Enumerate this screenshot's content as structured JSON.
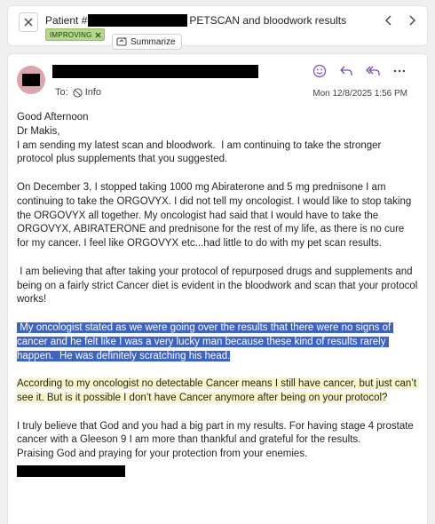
{
  "header": {
    "subject_prefix": "Patient #",
    "subject_suffix": "PETSCAN and bloodwork results",
    "badge": "IMPROVING",
    "summarize_label": "Summarize"
  },
  "message": {
    "to_label": "To:",
    "info_label": "Info",
    "date": "Mon 12/8/2025 1:56 PM",
    "greeting_1": "Good Afternoon",
    "greeting_2": "Dr Makis,",
    "p1": "I am sending my latest scan and bloodwork.  I am continuing to take the stronger protocol plus supplements that you suggested.",
    "p2": "On December 3, I stopped taking 1000 mg Abiraterone and 5 mg prednisone I am continuing to take the ORGOVYX. I did not tell my oncologist. I would like to stop taking the ORGOVYX all together. My oncologist had said that I would have to take the ORGOVYX, ABIRATERONE and prednisone for the rest of my life, as there is no cure for my cancer. I feel like ORGOVYX etc...had little to do with my pet scan results.",
    "p3": " I am believing that after taking your protocol of repurposed drugs and supplements and being on a fairly strict Cancer diet is evident in the bloodwork and scan that your protocol works!",
    "p4": " My oncologist stated as we were going over the results that there were no signs of cancer and he felt like I was a very lucky man because these kind of results rarely happen.  He was definitely scratching his head.",
    "p5": "According to my oncologist no detectable Cancer means I still have cancer, but just can’t see it. But is it possible I don’t have Cancer anymore after being on your protocol?",
    "p6": "I truly believe that God and you had a big part in my results. For having stage 4 prostate cancer with a Gleeson 9 I am more than thankful and grateful for the results.",
    "p7": "Praising God and praying for your protection from your enemies."
  },
  "colors": {
    "badge_bg": "#b4d88b",
    "selection": "#3b63c9",
    "highlight": "#f8f6c9",
    "icon_accent": "#7a4db3",
    "avatar": "#dca4ad"
  },
  "icons": [
    "close-icon",
    "sparkle-icon",
    "chevron-left-icon",
    "chevron-right-icon",
    "smiley-icon",
    "reply-icon",
    "reply-all-icon",
    "more-icon",
    "info-icon"
  ]
}
